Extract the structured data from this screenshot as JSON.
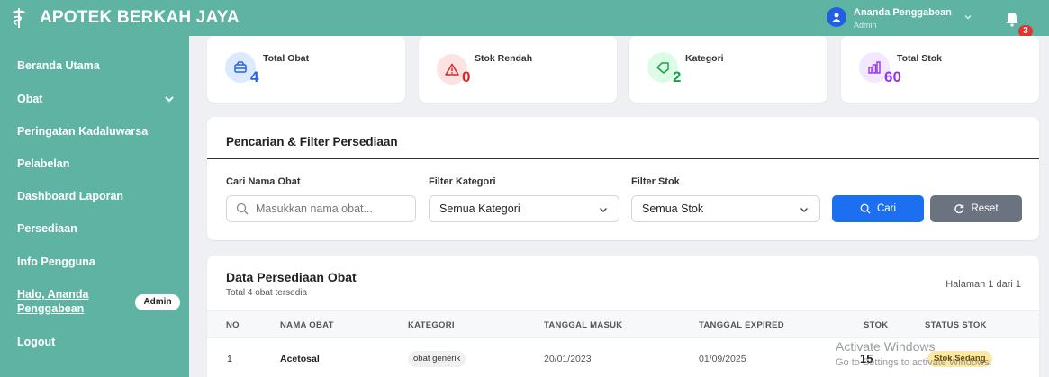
{
  "header": {
    "app_title": "APOTEK BERKAH JAYA",
    "user_name": "Ananda Penggabean",
    "user_role": "Admin",
    "notification_count": "3"
  },
  "sidebar": {
    "items": [
      {
        "label": "Beranda Utama"
      },
      {
        "label": "Obat"
      },
      {
        "label": "Peringatan Kadaluwarsa"
      },
      {
        "label": "Pelabelan"
      },
      {
        "label": "Dashboard Laporan"
      },
      {
        "label": "Persediaan"
      },
      {
        "label": "Info Pengguna"
      }
    ],
    "greeting": "Halo, Ananda Penggabean",
    "role_badge": "Admin",
    "logout": "Logout"
  },
  "stats": [
    {
      "label": "Total Obat",
      "value": "4",
      "color": "#2563eb",
      "icon": "box-icon"
    },
    {
      "label": "Stok Rendah",
      "value": "0",
      "color": "#dc2626",
      "icon": "warning-icon"
    },
    {
      "label": "Kategori",
      "value": "2",
      "color": "#16a34a",
      "icon": "tag-icon"
    },
    {
      "label": "Total Stok",
      "value": "60",
      "color": "#9333ea",
      "icon": "chart-icon"
    }
  ],
  "filter": {
    "title": "Pencarian & Filter Persediaan",
    "search_label": "Cari Nama Obat",
    "search_placeholder": "Masukkan nama obat...",
    "category_label": "Filter Kategori",
    "category_value": "Semua Kategori",
    "stock_label": "Filter Stok",
    "stock_value": "Semua Stok",
    "search_button": "Cari",
    "reset_button": "Reset"
  },
  "table": {
    "title": "Data Persediaan Obat",
    "subtitle": "Total 4 obat tersedia",
    "page_info": "Halaman 1 dari 1",
    "columns": [
      "NO",
      "NAMA OBAT",
      "KATEGORI",
      "TANGGAL MASUK",
      "TANGGAL EXPIRED",
      "STOK",
      "STATUS STOK"
    ],
    "rows": [
      {
        "no": "1",
        "name": "Acetosal",
        "category": "obat generik",
        "date_in": "20/01/2023",
        "date_exp": "01/09/2025",
        "stock": "15",
        "status": "Stok Sedang"
      }
    ]
  },
  "watermark": {
    "line1": "Activate Windows",
    "line2": "Go to Settings to activate Windows."
  }
}
